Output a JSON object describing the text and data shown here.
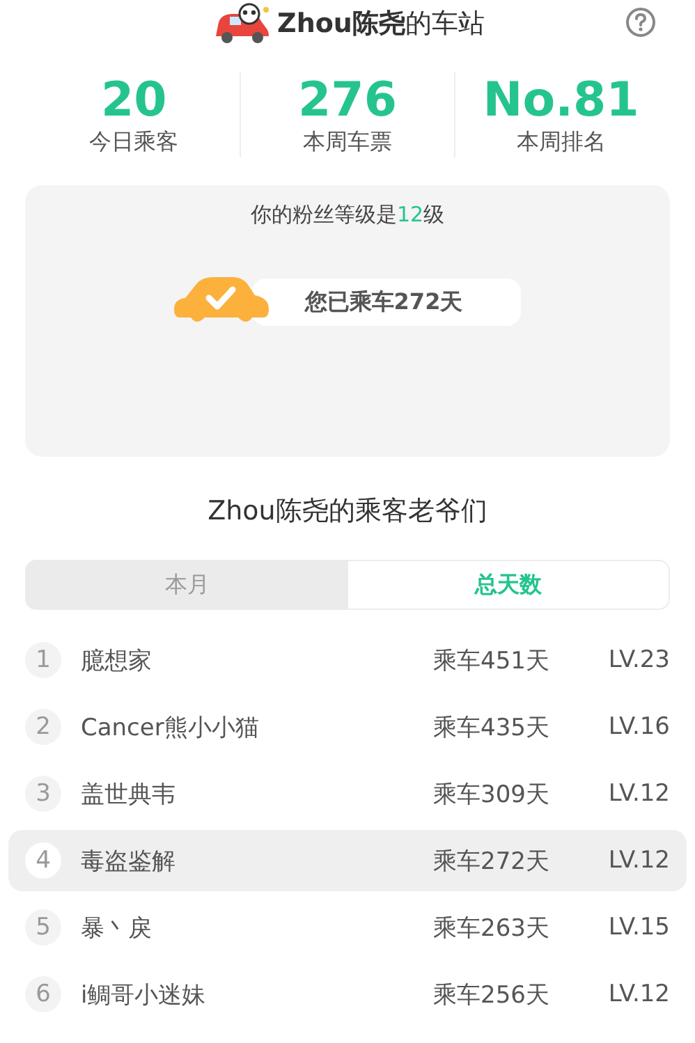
{
  "header": {
    "title": "**Zhou陈尧**的车站"
  },
  "stats": [
    {
      "value": "20",
      "label": "今日乘客"
    },
    {
      "value": "276",
      "label": "本周车票"
    },
    {
      "value": "No.81",
      "label": "本周排名"
    }
  ],
  "fan_card": {
    "prefix": "你的粉丝等级是",
    "level": "12",
    "suffix": "级",
    "ride_badge": "您已乘车272天"
  },
  "section_title": "Zhou陈尧的乘客老爷们",
  "tabs": [
    {
      "label": "本月",
      "selected": false
    },
    {
      "label": "总天数",
      "selected": true
    }
  ],
  "rows": [
    {
      "rank": "1",
      "name": "臆想家",
      "days": "乘车451天",
      "level": "LV.23",
      "selected": false
    },
    {
      "rank": "2",
      "name": "Cancer熊小小猫",
      "days": "乘车435天",
      "level": "LV.16",
      "selected": false
    },
    {
      "rank": "3",
      "name": "盖世典韦",
      "days": "乘车309天",
      "level": "LV.12",
      "selected": false
    },
    {
      "rank": "4",
      "name": "毒盗鉴解",
      "days": "乘车272天",
      "level": "LV.12",
      "selected": true
    },
    {
      "rank": "5",
      "name": "暴丶戾",
      "days": "乘车263天",
      "level": "LV.15",
      "selected": false
    },
    {
      "rank": "6",
      "name": "i鲷哥小迷妹",
      "days": "乘车256天",
      "level": "LV.12",
      "selected": false
    }
  ]
}
